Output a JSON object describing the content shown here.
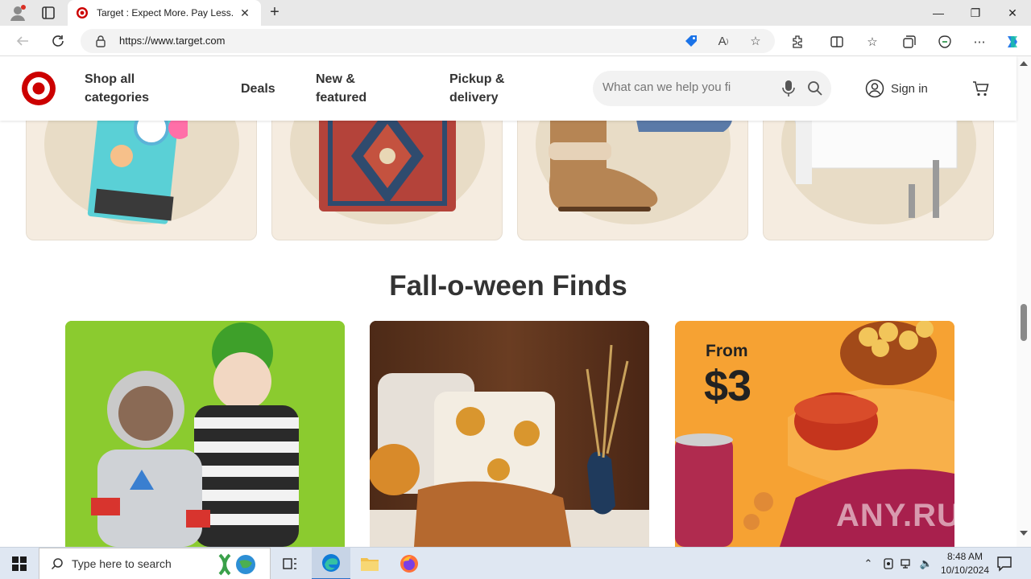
{
  "browser": {
    "tab_title": "Target : Expect More. Pay Less.",
    "tab_close": "✕",
    "new_tab": "+",
    "url": "https://www.target.com",
    "window": {
      "minimize": "—",
      "maximize": "❐",
      "close": "✕"
    }
  },
  "header": {
    "nav": [
      {
        "label": "Shop all categories"
      },
      {
        "label": "Deals"
      },
      {
        "label": "New & featured"
      },
      {
        "label": "Pickup & delivery"
      }
    ],
    "search_placeholder": "What can we help you fi",
    "signin": "Sign in"
  },
  "section": {
    "title": "Fall-o-ween Finds"
  },
  "promos": {
    "from": "From",
    "price": "$3"
  },
  "watermark": "ANY.RUN",
  "taskbar": {
    "search_placeholder": "Type here to search",
    "time": "8:48 AM",
    "date": "10/10/2024"
  },
  "colors": {
    "target_red": "#cc0000",
    "page_text": "#333333",
    "card_bg": "#f5ece0"
  }
}
